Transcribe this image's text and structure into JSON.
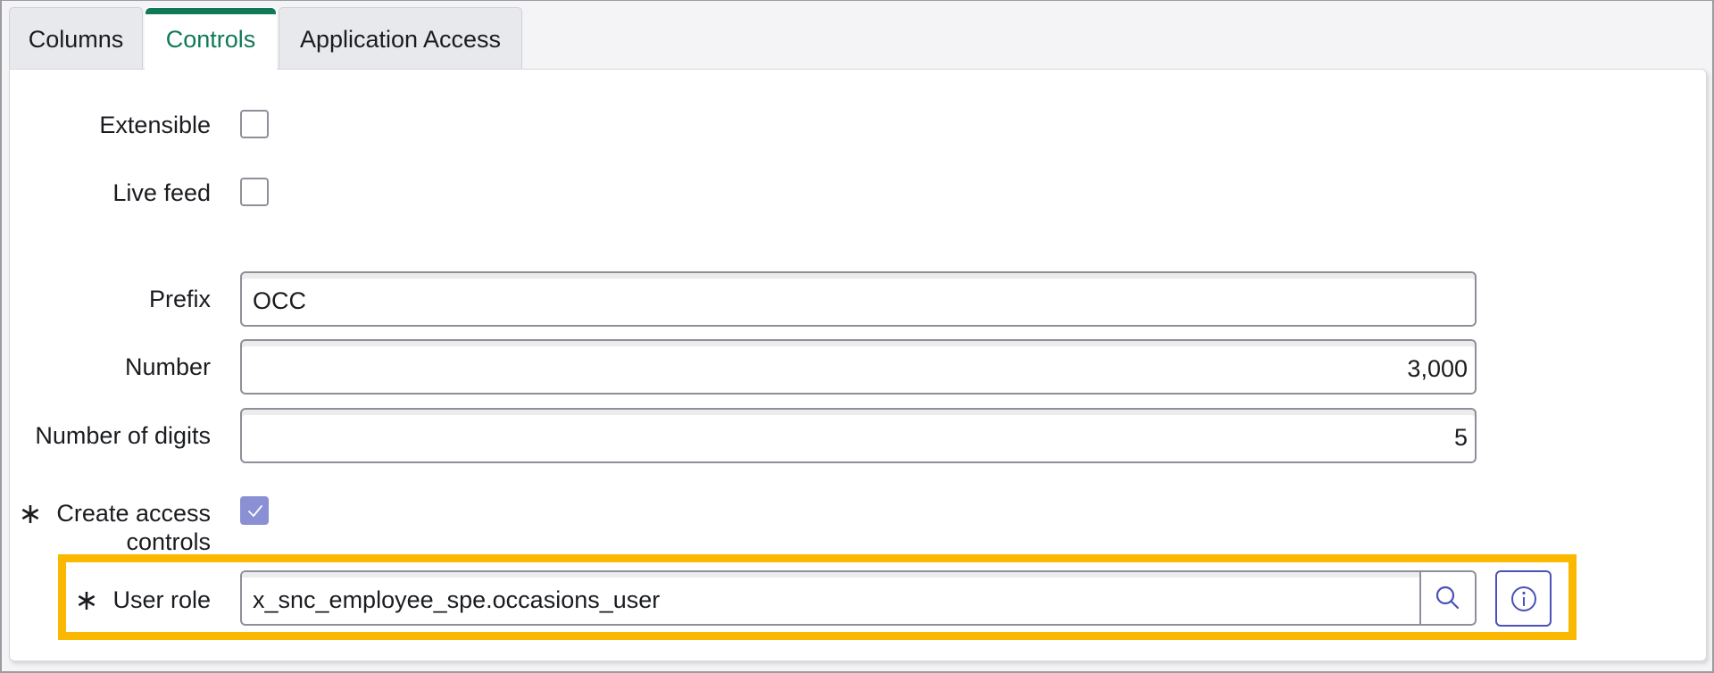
{
  "tabs": [
    {
      "label": "Columns",
      "active": false
    },
    {
      "label": "Controls",
      "active": true
    },
    {
      "label": "Application Access",
      "active": false
    }
  ],
  "form": {
    "extensible": {
      "label": "Extensible",
      "checked": false
    },
    "live_feed": {
      "label": "Live feed",
      "checked": false
    },
    "prefix": {
      "label": "Prefix",
      "value": "OCC"
    },
    "number": {
      "label": "Number",
      "value": "3,000"
    },
    "number_of_digits": {
      "label": "Number of digits",
      "value": "5"
    },
    "create_access_controls": {
      "label_line1": "Create access",
      "label_line2": "controls",
      "required_mark": "∗",
      "checked": true
    },
    "user_role": {
      "label": "User role",
      "required_mark": "∗",
      "value": "x_snc_employee_spe.occasions_user"
    }
  },
  "icons": {
    "search": "search-icon",
    "info": "info-icon",
    "check": "checkmark-icon"
  },
  "colors": {
    "accent_green": "#0f7a55",
    "checkbox_checked": "#8b8fd4",
    "button_border": "#4a51b8",
    "highlight": "#fbb800"
  }
}
